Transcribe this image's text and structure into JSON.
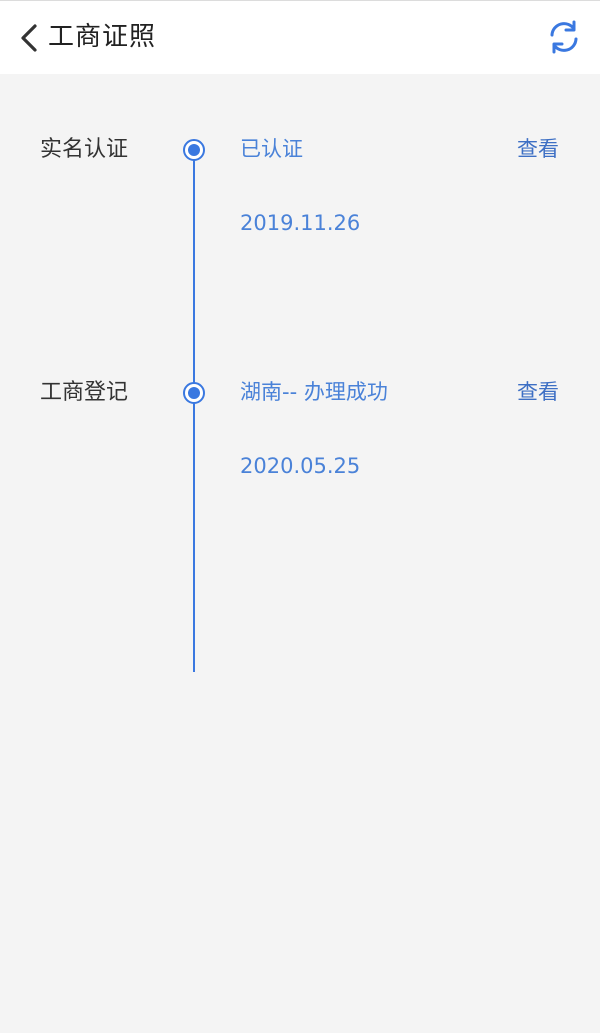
{
  "header": {
    "title": "工商证照"
  },
  "timeline": {
    "entries": [
      {
        "label": "实名认证",
        "status": "已认证",
        "date": "2019.11.26",
        "action": "查看"
      },
      {
        "label": "工商登记",
        "status": "湖南-- 办理成功",
        "date": "2020.05.25",
        "action": "查看"
      }
    ]
  },
  "colors": {
    "accent": "#3a78e0",
    "background": "#f4f4f4",
    "header_bg": "#ffffff"
  }
}
